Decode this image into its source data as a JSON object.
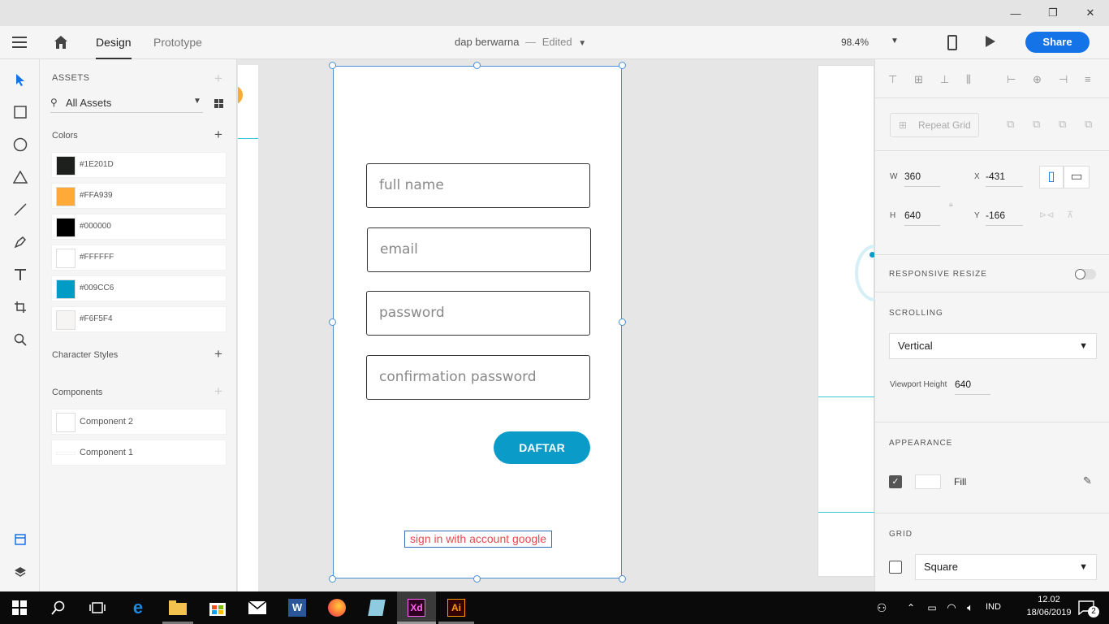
{
  "window": {
    "minimize": "—",
    "restore": "❐",
    "close": "✕"
  },
  "appbar": {
    "menu_icon": "hamburger-icon",
    "home_icon": "home-icon",
    "tabs": [
      {
        "label": "Design",
        "active": true
      },
      {
        "label": "Prototype",
        "active": false
      }
    ],
    "doc_name": "dap berwarna",
    "doc_separator": "—",
    "doc_status": "Edited",
    "zoom": "98.4%",
    "share_label": "Share"
  },
  "assets": {
    "header": "ASSETS",
    "filter": "All Assets",
    "colors_label": "Colors",
    "colors": [
      {
        "hex": "#1E201D",
        "label": "#1E201D"
      },
      {
        "hex": "#FFA939",
        "label": "#FFA939"
      },
      {
        "hex": "#000000",
        "label": "#000000"
      },
      {
        "hex": "#FFFFFF",
        "label": "#FFFFFF"
      },
      {
        "hex": "#009CC6",
        "label": "#009CC6"
      },
      {
        "hex": "#F6F5F4",
        "label": "#F6F5F4"
      }
    ],
    "char_styles_label": "Character Styles",
    "components_label": "Components",
    "components": [
      {
        "label": "Component 2"
      },
      {
        "label": "Component 1"
      }
    ]
  },
  "artboard": {
    "fields": [
      {
        "placeholder": "full name"
      },
      {
        "placeholder": "email"
      },
      {
        "placeholder": "password"
      },
      {
        "placeholder": "confirmation password"
      }
    ],
    "button_label": "DAFTAR",
    "google_link": "sign in with account google",
    "accent_color": "#0B9BC9",
    "link_color": "#E8484E"
  },
  "props": {
    "repeat_grid": "Repeat Grid",
    "w_label": "W",
    "w_value": "360",
    "x_label": "X",
    "x_value": "-431",
    "h_label": "H",
    "h_value": "640",
    "y_label": "Y",
    "y_value": "-166",
    "responsive_resize": "RESPONSIVE RESIZE",
    "scrolling_label": "SCROLLING",
    "scrolling_value": "Vertical",
    "viewport_label": "Viewport Height",
    "viewport_value": "640",
    "appearance_label": "APPEARANCE",
    "fill_label": "Fill",
    "grid_label": "GRID",
    "grid_value": "Square"
  },
  "taskbar": {
    "lang": "IND",
    "time": "12.02",
    "date": "18/06/2019",
    "notif_count": "2"
  }
}
